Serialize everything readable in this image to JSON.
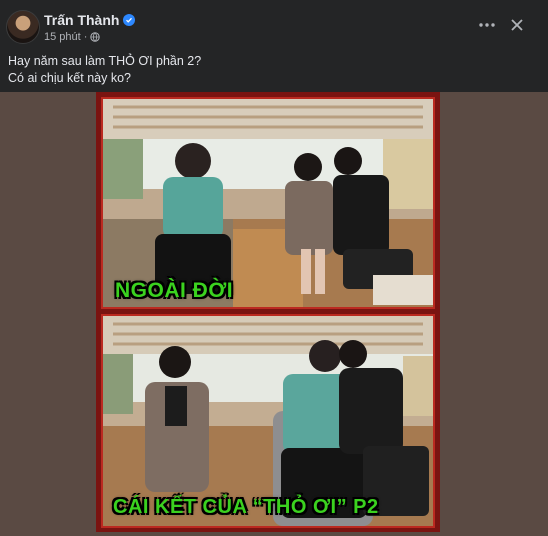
{
  "post": {
    "author": "Trấn Thành",
    "time": "15 phút",
    "caption_lines": [
      "Hay năm sau làm THỎ ƠI phần 2?",
      "Có ai chịu kết này ko?"
    ]
  },
  "icons": {
    "avatar": "avatar",
    "verified": "verified-badge-icon",
    "audience": "globe-icon",
    "more": "more-horizontal-icon",
    "close": "close-icon"
  },
  "media": {
    "top_caption": "NGOÀI ĐỜI",
    "bottom_caption": "CÁI KẾT CỦA “THỎ ƠI” P2"
  },
  "colors": {
    "background": "#242526",
    "text": "#e4e6eb",
    "secondary_text": "#b0b3b8",
    "verified": "#2d88ff",
    "overlay_text": "#3bd21f",
    "frame": "#7a1411"
  }
}
